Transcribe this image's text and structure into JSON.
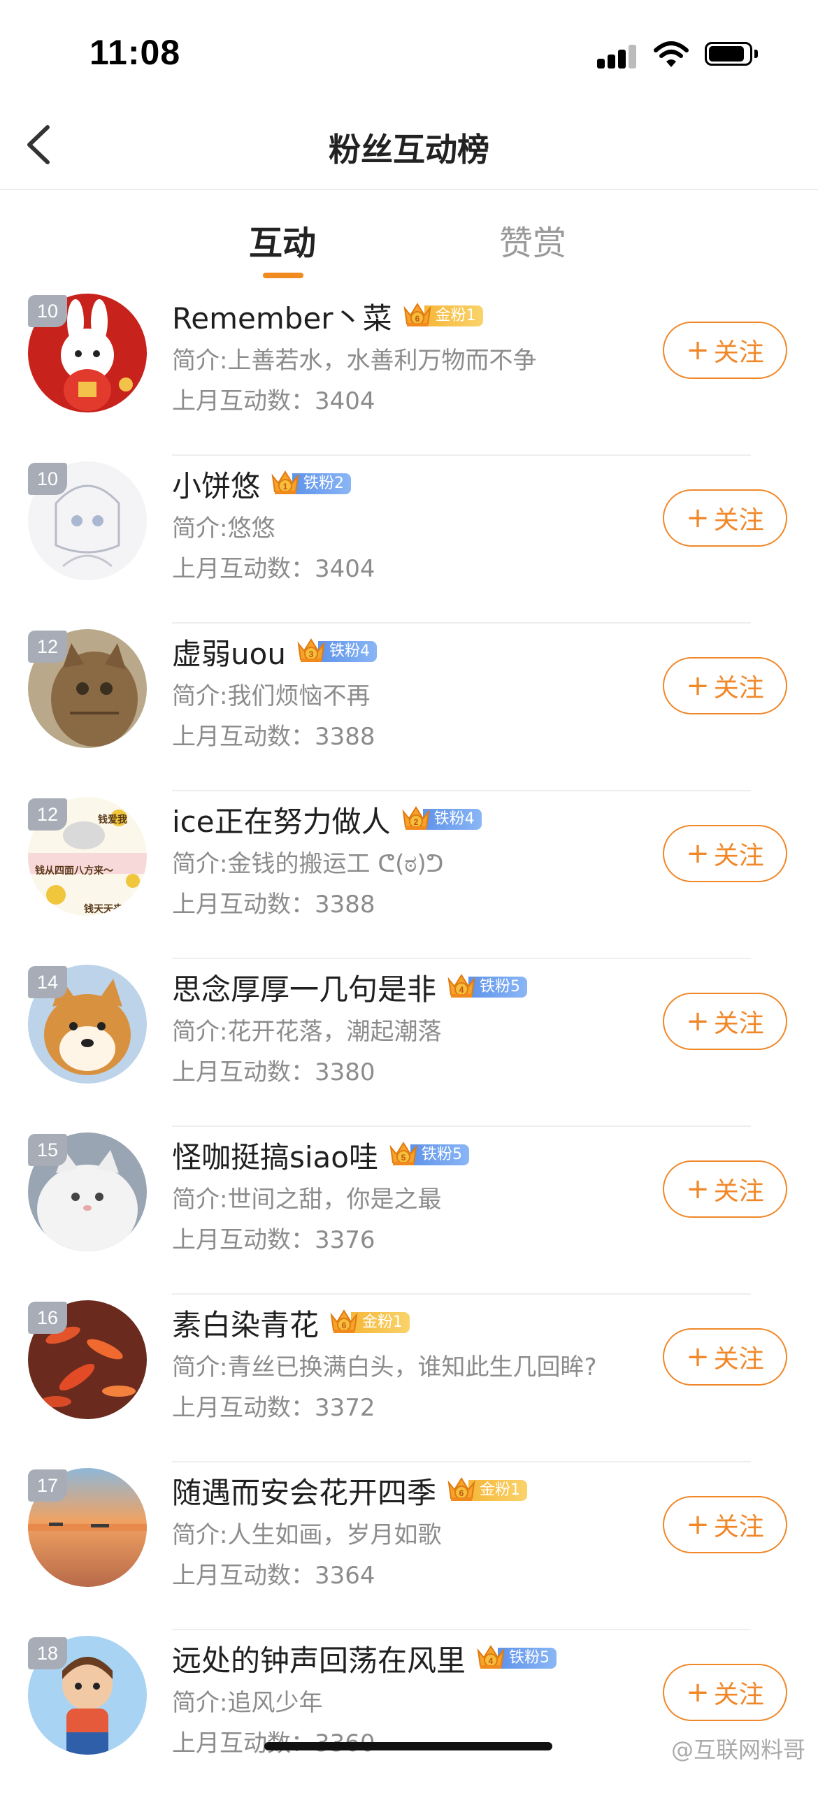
{
  "status_bar": {
    "time": "11:08"
  },
  "nav": {
    "title": "粉丝互动榜"
  },
  "tabs": [
    {
      "label": "互动",
      "active": true
    },
    {
      "label": "赞赏",
      "active": false
    }
  ],
  "follow_label": "关注",
  "colors": {
    "accent": "#f0882a",
    "gold_badge": "#f6b73a",
    "iron_badge": "#5f93ea",
    "rank_badge": "#a8acb6"
  },
  "users": [
    {
      "rank": "10",
      "name": "Remember丶菜",
      "badge": {
        "type": "gold",
        "label": "金粉1",
        "level": "6"
      },
      "bio": "简介:上善若水，水善利万物而不争",
      "interact": "上月互动数：3404",
      "avatar_icon": "rabbit-avatar"
    },
    {
      "rank": "10",
      "name": "小饼悠",
      "badge": {
        "type": "iron",
        "label": "铁粉2",
        "level": "1"
      },
      "bio": "简介:悠悠",
      "interact": "上月互动数：3404",
      "avatar_icon": "sketch-girl-avatar"
    },
    {
      "rank": "12",
      "name": "虚弱uou",
      "badge": {
        "type": "iron",
        "label": "铁粉4",
        "level": "3"
      },
      "bio": "简介:我们烦恼不再",
      "interact": "上月互动数：3388",
      "avatar_icon": "tabby-cat-avatar"
    },
    {
      "rank": "12",
      "name": "ice正在努力做人",
      "badge": {
        "type": "iron",
        "label": "铁粉4",
        "level": "2"
      },
      "bio": "简介:金钱的搬运工 ᕦ(ಠ)ᕤ",
      "interact": "上月互动数：3388",
      "avatar_icon": "money-meme-avatar",
      "avatar_texts": [
        "钱爱我",
        "钱从四面八方来～",
        "钱天天来"
      ]
    },
    {
      "rank": "14",
      "name": "思念厚厚一几句是非",
      "badge": {
        "type": "iron",
        "label": "铁粉5",
        "level": "4"
      },
      "bio": "简介:花开花落，潮起潮落",
      "interact": "上月互动数：3380",
      "avatar_icon": "shiba-dog-avatar"
    },
    {
      "rank": "15",
      "name": "怪咖挺搞siao哇",
      "badge": {
        "type": "iron",
        "label": "铁粉5",
        "level": "5"
      },
      "bio": "简介:世间之甜，你是之最",
      "interact": "上月互动数：3376",
      "avatar_icon": "white-cat-avatar"
    },
    {
      "rank": "16",
      "name": "素白染青花",
      "badge": {
        "type": "gold",
        "label": "金粉1",
        "level": "6"
      },
      "bio": "简介:青丝已换满白头，谁知此生几回眸?",
      "interact": "上月互动数：3372",
      "avatar_icon": "koi-fish-avatar"
    },
    {
      "rank": "17",
      "name": "随遇而安会花开四季",
      "badge": {
        "type": "gold",
        "label": "金粉1",
        "level": "6"
      },
      "bio": "简介:人生如画，岁月如歌",
      "interact": "上月互动数：3364",
      "avatar_icon": "sunset-beach-avatar"
    },
    {
      "rank": "18",
      "name": "远处的钟声回荡在风里",
      "badge": {
        "type": "iron",
        "label": "铁粉5",
        "level": "4"
      },
      "bio": "简介:追风少年",
      "interact": "上月互动数：3360",
      "avatar_icon": "cartoon-boy-avatar"
    }
  ],
  "watermark": "@互联网料哥"
}
